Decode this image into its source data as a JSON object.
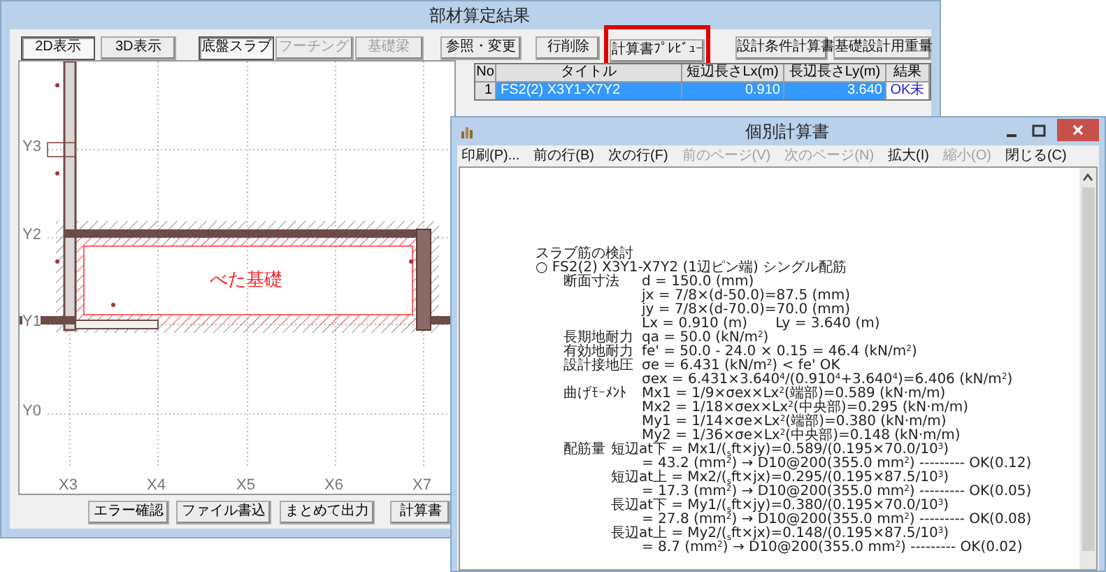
{
  "main_window": {
    "title": "部材算定結果",
    "toolbar": [
      {
        "label": "2D表示",
        "selected": true,
        "disabled": false,
        "highlighted": false
      },
      {
        "label": "3D表示",
        "selected": false,
        "disabled": false,
        "highlighted": false
      },
      {
        "label": "底盤スラブ",
        "selected": true,
        "disabled": false,
        "highlighted": false
      },
      {
        "label": "フーチング",
        "selected": false,
        "disabled": true,
        "highlighted": false
      },
      {
        "label": "基礎梁",
        "selected": false,
        "disabled": true,
        "highlighted": false
      },
      {
        "label": "参照・変更",
        "selected": false,
        "disabled": false,
        "highlighted": false
      },
      {
        "label": "行削除",
        "selected": false,
        "disabled": false,
        "highlighted": false
      },
      {
        "label": "計算書ﾌﾟﾚﾋﾞｭｰ",
        "selected": false,
        "disabled": false,
        "highlighted": true
      },
      {
        "label": "設計条件計算書",
        "selected": false,
        "disabled": false,
        "highlighted": false
      },
      {
        "label": "基礎設計用重量",
        "selected": false,
        "disabled": false,
        "highlighted": false
      }
    ],
    "plan": {
      "x_axes": [
        "X3",
        "X4",
        "X5",
        "X6",
        "X7"
      ],
      "y_axes": [
        "Y3",
        "Y2",
        "Y1",
        "Y0"
      ],
      "slab_label": "べた基礎"
    },
    "table": {
      "columns": [
        "No",
        "タイトル",
        "短辺長さLx(m)",
        "長辺長さLy(m)",
        "結果"
      ],
      "rows": [
        {
          "cells": [
            "1",
            "FS2(2) X3Y1-X7Y2",
            "0.910",
            "3.640",
            "OK未"
          ],
          "selected": true
        }
      ]
    },
    "bottom_buttons": [
      "エラー確認",
      "ファイル書込",
      "まとめて出力",
      "計算書"
    ]
  },
  "preview_window": {
    "title": "個別計算書",
    "menu": [
      {
        "label": "印刷(P)...",
        "disabled": false
      },
      {
        "label": "前の行(B)",
        "disabled": false
      },
      {
        "label": "次の行(F)",
        "disabled": false
      },
      {
        "label": "前のページ(V)",
        "disabled": true
      },
      {
        "label": "次のページ(N)",
        "disabled": true
      },
      {
        "label": "拡大(I)",
        "disabled": false
      },
      {
        "label": "縮小(O)",
        "disabled": true
      },
      {
        "label": "閉じる(C)",
        "disabled": false
      }
    ],
    "document": [
      {
        "kind": "heading",
        "text": "スラブ筋の検討"
      },
      {
        "kind": "heading",
        "text": "○ FS2(2) X3Y1-X7Y2 (1辺ピン端) シングル配筋"
      },
      {
        "kind": "row",
        "label": "断面寸法",
        "text": "d = 150.0 (mm)"
      },
      {
        "kind": "row",
        "text": "jx = 7/8×(d-50.0)=87.5 (mm)"
      },
      {
        "kind": "row",
        "text": "jy = 7/8×(d-70.0)=70.0 (mm)"
      },
      {
        "kind": "row",
        "text": "Lx = 0.910 (m)　　Ly = 3.640 (m)"
      },
      {
        "kind": "row",
        "label": "長期地耐力",
        "text": "qa = 50.0 (kN/m$^{2}$)"
      },
      {
        "kind": "row",
        "label": "有効地耐力",
        "text": "fe' = 50.0 - 24.0 × 0.15 = 46.4 (kN/m$^{2}$)"
      },
      {
        "kind": "row",
        "label": "設計接地圧",
        "text": "σe = 6.431 (kN/m$^{2}$) < fe' OK"
      },
      {
        "kind": "row",
        "text": "σex = 6.431×3.640$^{4}$/(0.910$^{4}$+3.640$^{4}$)=6.406 (kN/m$^{2}$)"
      },
      {
        "kind": "row",
        "label": "曲げﾓｰﾒﾝﾄ",
        "text": "Mx1 = 1/9×σex×Lx$^{2}$(端部)=0.589 (kN·m/m)"
      },
      {
        "kind": "row",
        "text": "Mx2 = 1/18×σex×Lx$^{2}$(中央部)=0.295 (kN·m/m)"
      },
      {
        "kind": "row",
        "text": "My1 = 1/14×σe×Lx$^{2}$(端部)=0.380 (kN·m/m)"
      },
      {
        "kind": "row",
        "text": "My2 = 1/36×σe×Lx$^{2}$(中央部)=0.148 (kN·m/m)"
      },
      {
        "kind": "sub",
        "label": "配筋量",
        "sublabel": "短辺at下",
        "text": "= Mx1/($_{s}$ft×jy)=0.589/(0.195×70.0/10$^{3}$)"
      },
      {
        "kind": "row",
        "text": "= 43.2 (mm$^{2}$) → D10@200(355.0 mm$^{2}$) --------- OK(0.12)"
      },
      {
        "kind": "sub",
        "sublabel": "短辺at上",
        "text": "= Mx2/($_{s}$ft×jx)=0.295/(0.195×87.5/10$^{3}$)"
      },
      {
        "kind": "row",
        "text": "= 17.3 (mm$^{2}$) → D10@200(355.0 mm$^{2}$) --------- OK(0.05)"
      },
      {
        "kind": "sub",
        "sublabel": "長辺at下",
        "text": "= My1/($_{s}$ft×jy)=0.380/(0.195×70.0/10$^{3}$)"
      },
      {
        "kind": "row",
        "text": "= 27.8 (mm$^{2}$) → D10@200(355.0 mm$^{2}$) --------- OK(0.08)"
      },
      {
        "kind": "sub",
        "sublabel": "長辺at上",
        "text": "= My2/($_{s}$ft×jx)=0.148/(0.195×87.5/10$^{3}$)"
      },
      {
        "kind": "row",
        "text": "= 8.7 (mm$^{2}$) → D10@200(355.0 mm$^{2}$) --------- OK(0.02)"
      }
    ]
  }
}
